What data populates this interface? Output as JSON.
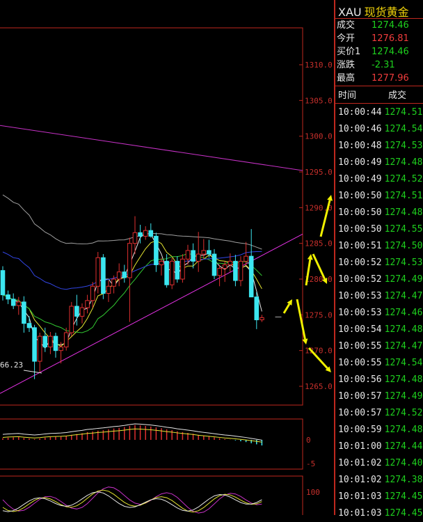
{
  "header": {
    "symbol": "XAU",
    "name": "现货黄金"
  },
  "quote": [
    {
      "label": "成交",
      "value": "1274.46",
      "tone": "pos"
    },
    {
      "label": "今开",
      "value": "1276.81",
      "tone": "neg"
    },
    {
      "label": "买价1",
      "value": "1274.46",
      "tone": "pos"
    },
    {
      "label": "涨跌",
      "value": "-2.31",
      "tone": "pos"
    },
    {
      "label": "最高",
      "value": "1277.96",
      "tone": "neg"
    }
  ],
  "ticks_header": {
    "time": "时间",
    "price": "成交"
  },
  "ticks": [
    {
      "time": "10:00:44",
      "price": "1274.51"
    },
    {
      "time": "10:00:46",
      "price": "1274.54"
    },
    {
      "time": "10:00:48",
      "price": "1274.53"
    },
    {
      "time": "10:00:49",
      "price": "1274.48"
    },
    {
      "time": "10:00:49",
      "price": "1274.52"
    },
    {
      "time": "10:00:50",
      "price": "1274.51"
    },
    {
      "time": "10:00:50",
      "price": "1274.48"
    },
    {
      "time": "10:00:50",
      "price": "1274.55"
    },
    {
      "time": "10:00:51",
      "price": "1274.50"
    },
    {
      "time": "10:00:52",
      "price": "1274.53"
    },
    {
      "time": "10:00:52",
      "price": "1274.49"
    },
    {
      "time": "10:00:53",
      "price": "1274.47"
    },
    {
      "time": "10:00:53",
      "price": "1274.46"
    },
    {
      "time": "10:00:54",
      "price": "1274.48"
    },
    {
      "time": "10:00:55",
      "price": "1274.47"
    },
    {
      "time": "10:00:55",
      "price": "1274.54"
    },
    {
      "time": "10:00:56",
      "price": "1274.48"
    },
    {
      "time": "10:00:57",
      "price": "1274.49"
    },
    {
      "time": "10:00:57",
      "price": "1274.52"
    },
    {
      "time": "10:00:59",
      "price": "1274.48"
    },
    {
      "time": "10:01:00",
      "price": "1274.44"
    },
    {
      "time": "10:01:02",
      "price": "1274.40"
    },
    {
      "time": "10:01:02",
      "price": "1274.38"
    },
    {
      "time": "10:01:03",
      "price": "1274.45"
    },
    {
      "time": "10:01:03",
      "price": "1274.45"
    }
  ],
  "price_axis": {
    "labels": [
      "1310.0",
      "1305.0",
      "1300.0",
      "1295.0",
      "1290.0",
      "1285.0",
      "1280.0",
      "1275.0",
      "1270.0",
      "1265.0"
    ],
    "top_value": 1310.0,
    "bottom_value": 1265.0
  },
  "low_label": "66.23",
  "macd_axis": {
    "labels": [
      "0",
      "-5"
    ]
  },
  "osc_axis": {
    "labels": [
      "100"
    ]
  },
  "candles": [
    [
      1281.2,
      1281.8,
      1277.0,
      1277.8
    ],
    [
      1277.8,
      1278.4,
      1276.5,
      1277.2
    ],
    [
      1277.2,
      1278.0,
      1275.8,
      1276.3
    ],
    [
      1276.3,
      1277.5,
      1275.0,
      1276.8
    ],
    [
      1276.8,
      1277.6,
      1272.5,
      1273.8
    ],
    [
      1273.8,
      1274.8,
      1272.6,
      1273.2
    ],
    [
      1273.2,
      1273.6,
      1266.0,
      1268.5
    ],
    [
      1268.5,
      1272.5,
      1267.0,
      1272.0
    ],
    [
      1272.0,
      1273.2,
      1269.8,
      1270.5
    ],
    [
      1270.5,
      1272.6,
      1269.5,
      1272.0
    ],
    [
      1272.0,
      1272.5,
      1269.0,
      1270.0
    ],
    [
      1270.0,
      1271.2,
      1268.2,
      1270.5
    ],
    [
      1270.5,
      1273.2,
      1270.0,
      1272.5
    ],
    [
      1272.5,
      1276.8,
      1272.0,
      1276.2
    ],
    [
      1276.2,
      1277.8,
      1273.5,
      1274.8
    ],
    [
      1274.8,
      1276.6,
      1273.8,
      1276.0
    ],
    [
      1276.0,
      1277.8,
      1275.2,
      1277.0
    ],
    [
      1277.0,
      1279.6,
      1276.0,
      1279.0
    ],
    [
      1279.0,
      1283.8,
      1278.0,
      1283.0
    ],
    [
      1283.0,
      1283.5,
      1277.2,
      1278.0
    ],
    [
      1278.0,
      1279.8,
      1276.8,
      1279.0
    ],
    [
      1279.0,
      1280.5,
      1278.0,
      1280.0
    ],
    [
      1280.0,
      1282.2,
      1279.0,
      1281.0
    ],
    [
      1281.0,
      1282.0,
      1279.5,
      1280.2
    ],
    [
      1280.2,
      1285.8,
      1274.0,
      1285.0
    ],
    [
      1285.0,
      1288.8,
      1283.5,
      1286.5
    ],
    [
      1286.5,
      1287.6,
      1285.0,
      1286.0
    ],
    [
      1286.0,
      1287.4,
      1285.5,
      1286.8
    ],
    [
      1286.8,
      1287.8,
      1285.8,
      1286.0
    ],
    [
      1286.0,
      1286.5,
      1281.0,
      1282.0
    ],
    [
      1282.0,
      1283.0,
      1280.5,
      1282.5
    ],
    [
      1282.5,
      1283.5,
      1278.8,
      1279.2
    ],
    [
      1279.2,
      1283.0,
      1278.6,
      1282.5
    ],
    [
      1282.5,
      1283.2,
      1279.5,
      1280.0
    ],
    [
      1280.0,
      1283.5,
      1279.5,
      1282.8
    ],
    [
      1282.8,
      1284.8,
      1282.0,
      1284.0
    ],
    [
      1284.0,
      1285.0,
      1281.5,
      1282.5
    ],
    [
      1282.5,
      1286.6,
      1281.0,
      1283.5
    ],
    [
      1283.5,
      1285.6,
      1282.8,
      1284.0
    ],
    [
      1284.0,
      1285.5,
      1283.0,
      1283.5
    ],
    [
      1283.5,
      1284.2,
      1280.0,
      1280.5
    ],
    [
      1280.5,
      1282.0,
      1279.0,
      1281.5
    ],
    [
      1281.5,
      1282.5,
      1279.6,
      1282.0
    ],
    [
      1282.0,
      1283.6,
      1281.0,
      1282.5
    ],
    [
      1282.5,
      1283.4,
      1279.0,
      1279.8
    ],
    [
      1279.8,
      1283.2,
      1279.0,
      1282.5
    ],
    [
      1282.5,
      1285.2,
      1282.0,
      1283.2
    ],
    [
      1283.2,
      1287.0,
      1277.5,
      1277.5
    ],
    [
      1277.5,
      1278.2,
      1273.0,
      1274.3
    ],
    [
      1274.3,
      1275.0,
      1274.0,
      1274.6
    ]
  ],
  "colors": {
    "frame": "#c0281e",
    "up": "#e03030",
    "down": "#3ce6f0",
    "ma_purple": "#c832c8",
    "ma_gray": "#a0a0a0",
    "ma_blue": "#3246e6",
    "ma_green": "#32c832",
    "ma_white": "#e6e6e6",
    "ma_yellow": "#e6e632",
    "trend_magenta": "#e632e6",
    "arrow": "#f0f000"
  }
}
